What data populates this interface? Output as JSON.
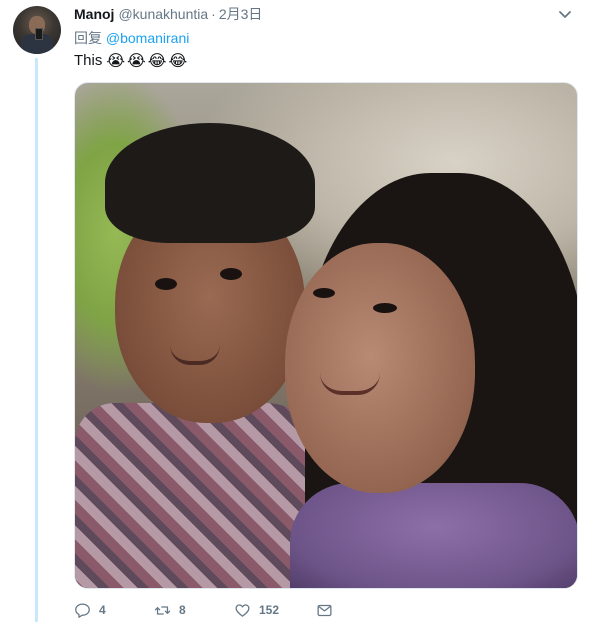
{
  "tweet": {
    "name": "Manoj",
    "handle": "@kunakhuntia",
    "separator": "·",
    "time": "2月3日",
    "reply_prefix": "回复",
    "reply_to": "@bomanirani",
    "text": "This",
    "emojis": [
      "😭",
      "😭",
      "😂",
      "😂"
    ]
  },
  "actions": {
    "replies": "4",
    "retweets": "8",
    "likes": "152"
  },
  "icons": {
    "menu": "chevron-down-icon",
    "reply": "reply-icon",
    "retweet": "retweet-icon",
    "like": "heart-icon",
    "dm": "envelope-icon"
  },
  "colors": {
    "accent": "#1da1f2",
    "thread_line": "#c9e7fb",
    "secondary_text": "#657786"
  }
}
